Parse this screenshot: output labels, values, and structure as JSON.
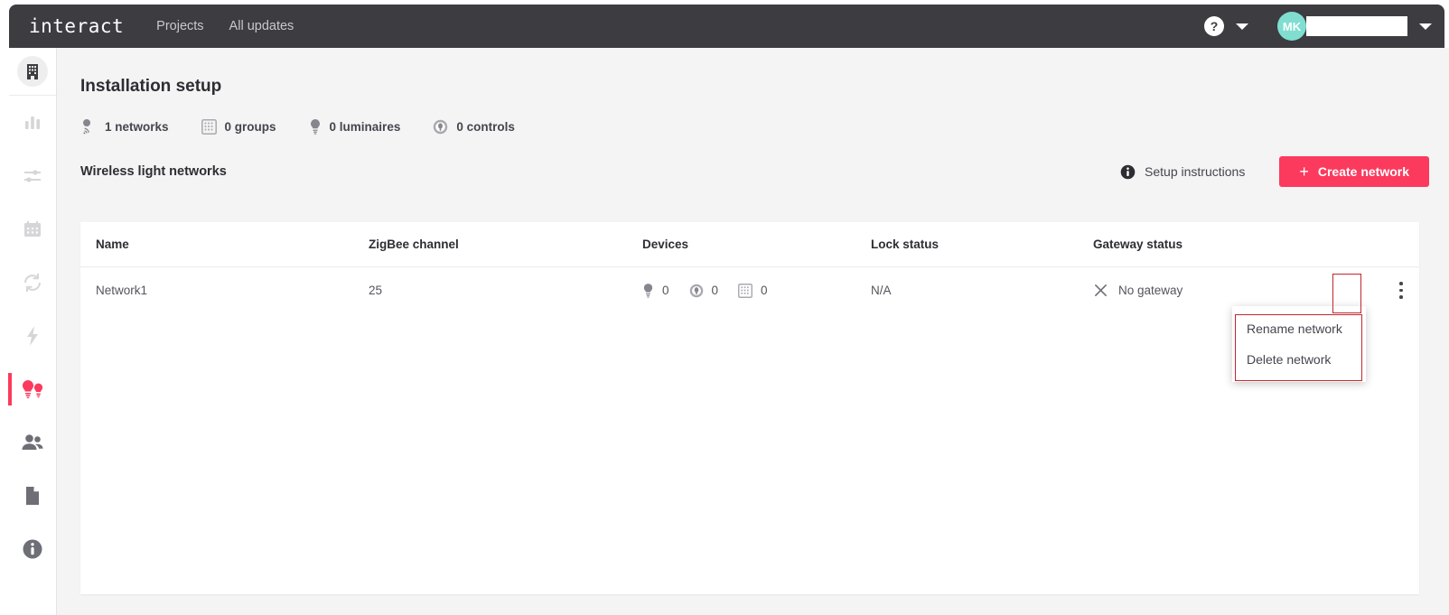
{
  "topbar": {
    "logo": "interact",
    "links": [
      {
        "label": "Projects"
      },
      {
        "label": "All updates"
      }
    ],
    "help_glyph": "?",
    "avatar_initials": "MK"
  },
  "sidebar": {
    "items": [
      {
        "name": "building",
        "label": "Installation",
        "active": false,
        "top": true
      },
      {
        "name": "bar-chart",
        "label": "Analytics",
        "active": false
      },
      {
        "name": "sliders",
        "label": "Settings",
        "active": false
      },
      {
        "name": "calendar",
        "label": "Schedules",
        "active": false
      },
      {
        "name": "sync",
        "label": "Sync",
        "active": false
      },
      {
        "name": "bolt",
        "label": "Energy",
        "active": false
      },
      {
        "name": "bulbs",
        "label": "Lighting",
        "active": true
      },
      {
        "name": "people",
        "label": "Users",
        "active": false
      },
      {
        "name": "document",
        "label": "Reports",
        "active": false
      },
      {
        "name": "info",
        "label": "About",
        "active": false
      }
    ]
  },
  "main": {
    "page_title": "Installation setup",
    "stats": [
      {
        "icon": "network-icon",
        "label": "1 networks"
      },
      {
        "icon": "groups-grid-icon",
        "label": "0 groups"
      },
      {
        "icon": "luminaire-bulb-icon",
        "label": "0 luminaires"
      },
      {
        "icon": "control-icon",
        "label": "0 controls"
      }
    ],
    "section_title": "Wireless light networks",
    "setup_instructions_label": "Setup instructions",
    "create_network_label": "Create network",
    "create_plus_glyph": "+",
    "table": {
      "columns": [
        "Name",
        "ZigBee channel",
        "Devices",
        "Lock status",
        "Gateway status"
      ],
      "rows": [
        {
          "name": "Network1",
          "zigbee_channel": "25",
          "devices": [
            {
              "icon": "luminaire-bulb-icon",
              "count": "0"
            },
            {
              "icon": "control-icon",
              "count": "0"
            },
            {
              "icon": "groups-grid-icon",
              "count": "0"
            }
          ],
          "lock_status": "N/A",
          "gateway_status": "No gateway",
          "gateway_icon": "close-x-icon"
        }
      ]
    },
    "row_menu": {
      "items": [
        {
          "label": "Rename network"
        },
        {
          "label": "Delete network"
        }
      ]
    }
  },
  "colors": {
    "accent": "#fb3a5d",
    "topbar_bg": "#3c3c41",
    "page_bg": "#f4f4f5",
    "avatar_bg": "#7fded0",
    "annotation": "#c0272d"
  }
}
